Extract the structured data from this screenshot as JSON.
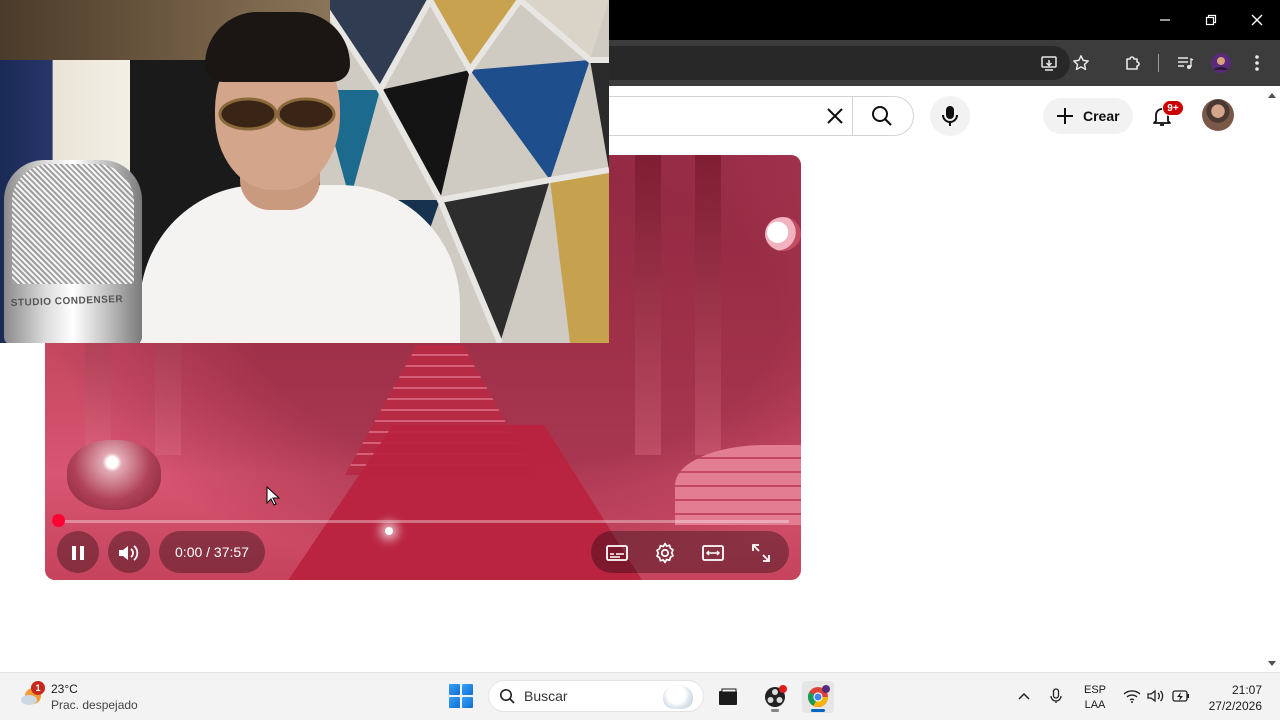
{
  "browser": {
    "window_controls": [
      "minimize-icon",
      "restore-icon",
      "close-icon"
    ],
    "toolbar_icons": [
      "install-app-icon",
      "bookmark-star-icon",
      "extensions-icon",
      "media-controls-icon",
      "profile-icon",
      "more-menu-icon"
    ]
  },
  "youtube": {
    "search": {
      "value": "",
      "clear_icon": "close-icon",
      "submit_icon": "search-icon"
    },
    "voice_icon": "mic-icon",
    "create_label": "Crear",
    "notifications_badge": "9+"
  },
  "player": {
    "current_time": "0:00",
    "duration": "37:57",
    "time_display": "0:00 / 37:57",
    "progress": 0.0,
    "state": "playing",
    "controls": [
      "pause-icon",
      "volume-icon",
      "subtitles-icon",
      "settings-icon",
      "theater-mode-icon",
      "fullscreen-icon"
    ],
    "accent_color": "#ff0033"
  },
  "webcam": {
    "mic_brand_text": "STUDIO CONDENSER"
  },
  "taskbar": {
    "weather": {
      "badge": "1",
      "temperature": "23°C",
      "description": "Prac. despejado"
    },
    "search_placeholder": "Buscar",
    "apps": [
      "file-explorer-icon",
      "obs-icon",
      "chrome-icon"
    ],
    "language_line1": "ESP",
    "language_line2": "LAA",
    "time": "21:07",
    "date": "27/2/2026"
  }
}
